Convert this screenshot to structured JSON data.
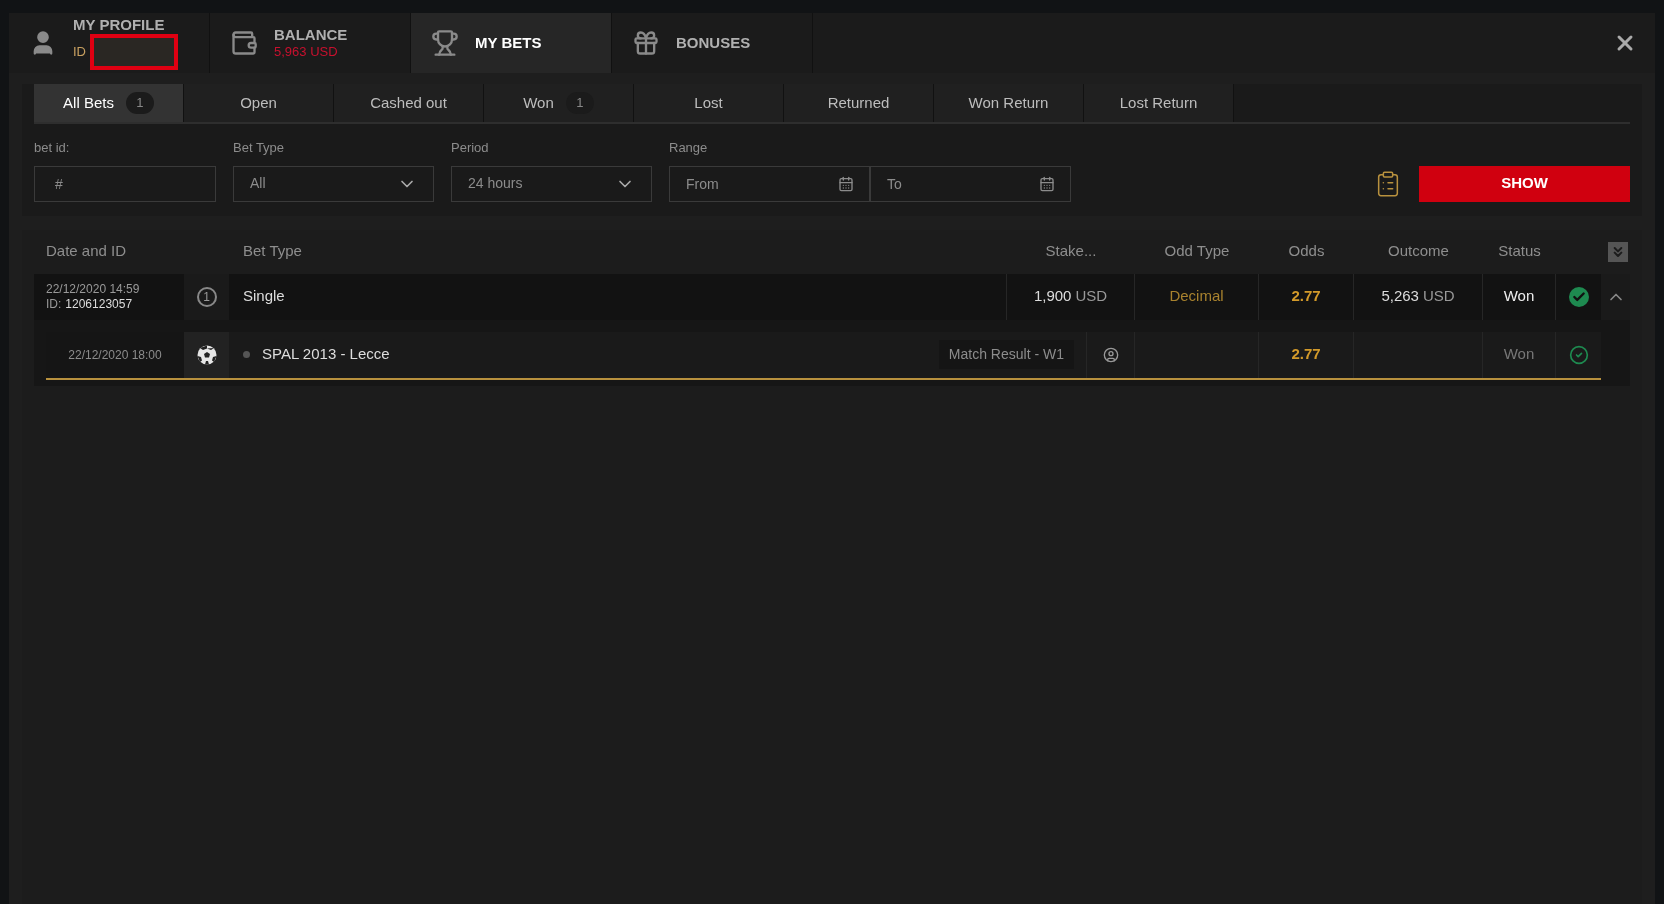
{
  "top_tabs": [
    {
      "kind": "profile",
      "title": "MY PROFILE",
      "subtitle": "ID",
      "redacted": true,
      "selected": false
    },
    {
      "kind": "balance",
      "title": "BALANCE",
      "subtitle": "5,963 USD",
      "selected": false
    },
    {
      "kind": "bets",
      "title": "MY BETS",
      "selected": true
    },
    {
      "kind": "gift",
      "title": "BONUSES",
      "selected": false
    }
  ],
  "filter_tabs": [
    {
      "label": "All Bets",
      "count": "1",
      "selected": true
    },
    {
      "label": "Open",
      "selected": false
    },
    {
      "label": "Cashed out",
      "selected": false
    },
    {
      "label": "Won",
      "count": "1",
      "selected": false
    },
    {
      "label": "Lost",
      "selected": false
    },
    {
      "label": "Returned",
      "selected": false
    },
    {
      "label": "Won Return",
      "selected": false
    },
    {
      "label": "Lost Return",
      "selected": false
    }
  ],
  "filters": {
    "bet_id": {
      "label": "bet id:",
      "placeholder": "#"
    },
    "bet_type": {
      "label": "Bet Type",
      "value": "All"
    },
    "period": {
      "label": "Period",
      "value": "24 hours"
    },
    "range": {
      "label": "Range",
      "from_placeholder": "From",
      "to_placeholder": "To"
    }
  },
  "show_button": "SHOW",
  "table": {
    "columns": [
      "Date and ID",
      "Bet Type",
      "Stake...",
      "Odd Type",
      "Odds",
      "Outcome",
      "Status"
    ],
    "bets": [
      {
        "date": "22/12/2020 14:59",
        "id_label": "ID:",
        "id": "1206123057",
        "count": "1",
        "type": "Single",
        "stake": "1,900",
        "stake_currency": "USD",
        "odd_type": "Decimal",
        "odds": "2.77",
        "outcome": "5,263",
        "outcome_currency": "USD",
        "status": "Won",
        "won": true,
        "expanded": true,
        "events": [
          {
            "date": "22/12/2020 18:00",
            "match": "SPAL 2013 - Lecce",
            "market": "Match Result - W1",
            "odds": "2.77",
            "status": "Won",
            "won": true
          }
        ]
      }
    ]
  }
}
